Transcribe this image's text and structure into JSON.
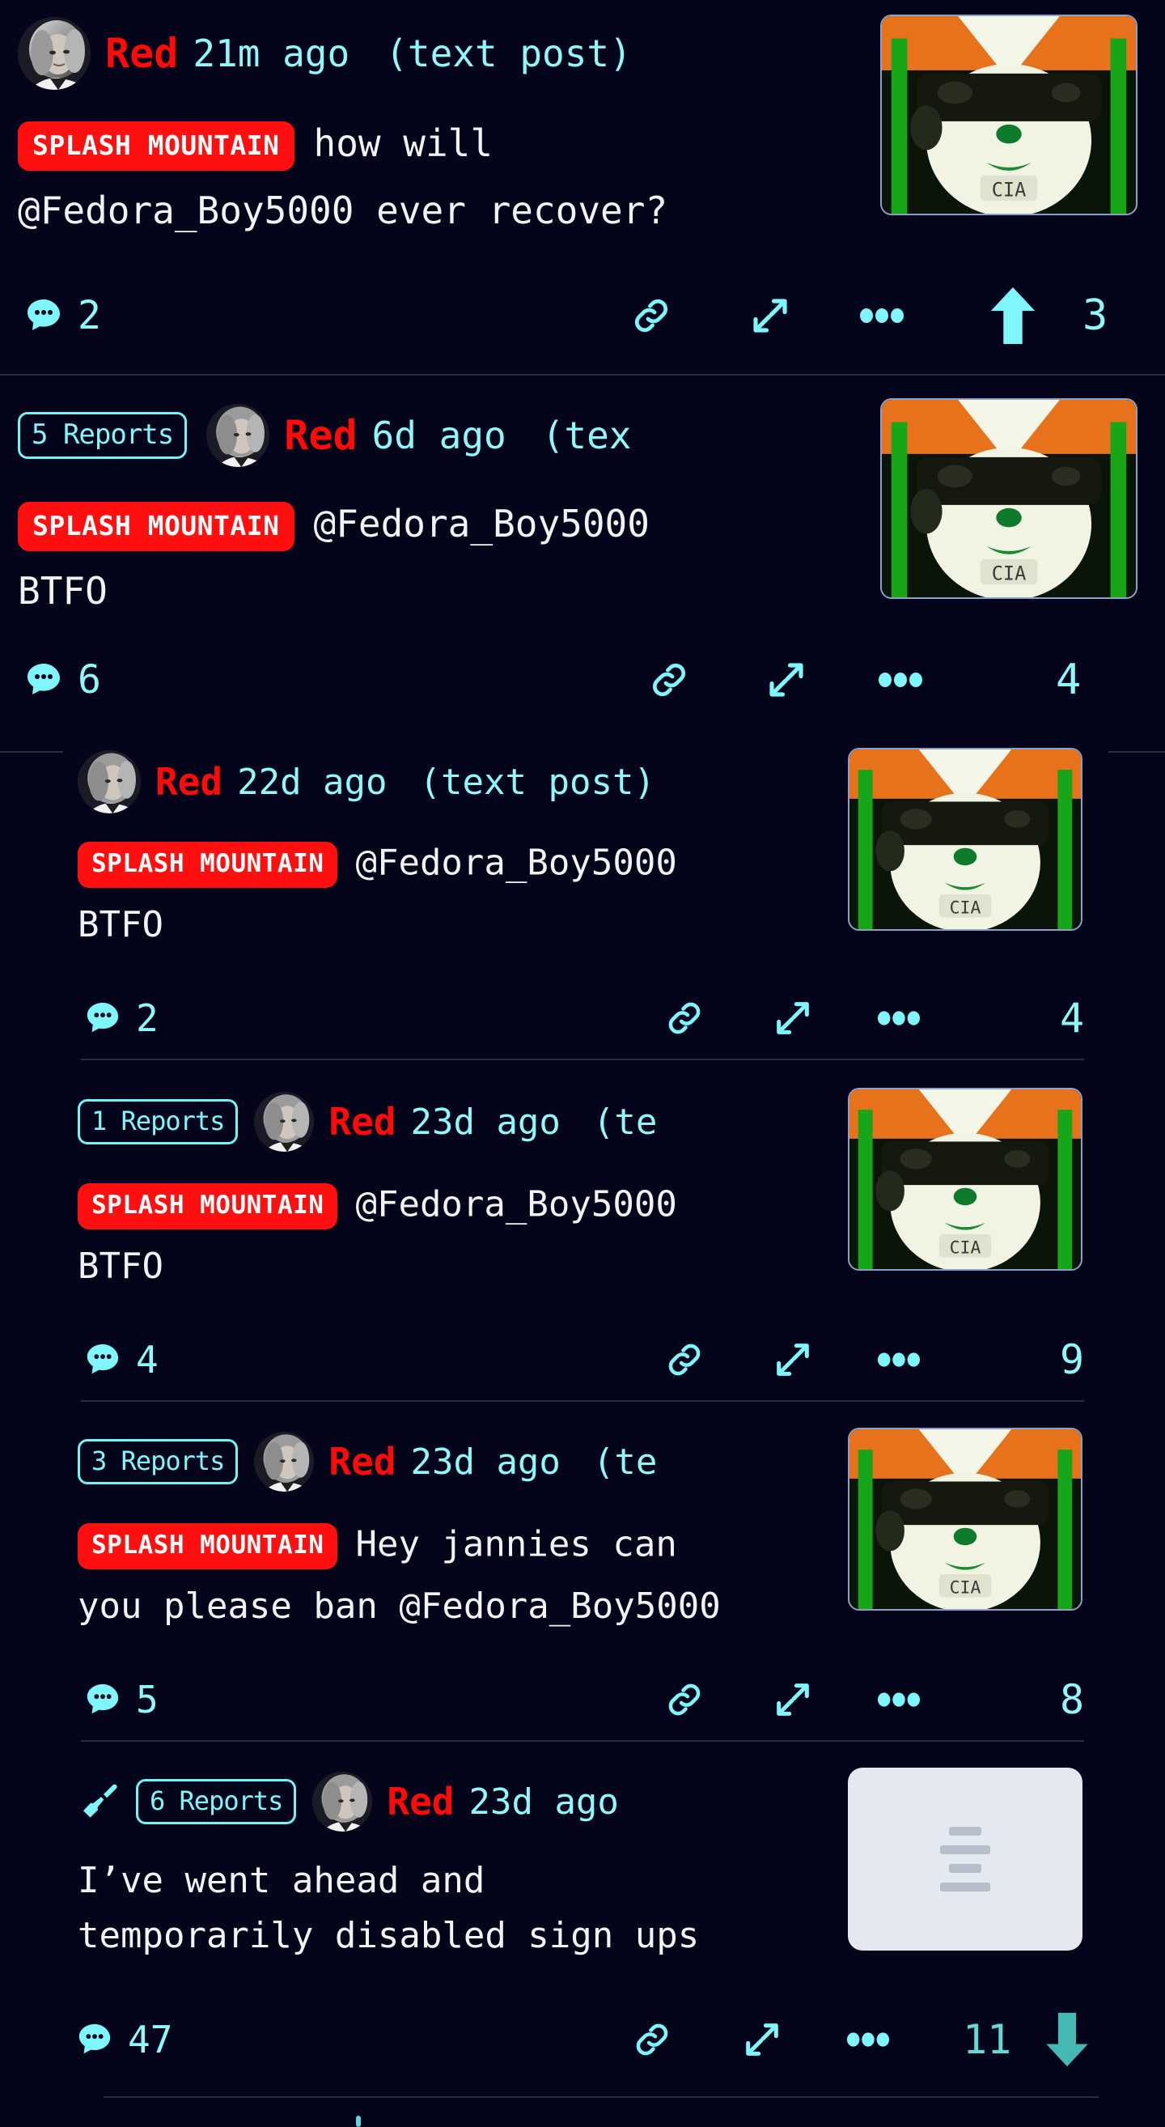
{
  "theme": {
    "background": "#04041a",
    "accent_cyan": "#7ef6fb",
    "username_red": "#ff0a0a",
    "flair_red": "#ff0f0f",
    "body_text": "#f2f2f7",
    "divider": "#2a2a46"
  },
  "posts": [
    {
      "id": "post-1",
      "reports": null,
      "mod_icon": null,
      "username": "Red",
      "timestamp": "21m ago",
      "post_type": "(text post)",
      "flair": "SPLASH MOUNTAIN",
      "body_lines": [
        "how will",
        "@Fedora_Boy5000 ever recover?"
      ],
      "comments": "2",
      "score": "3",
      "vote": "up",
      "thumbnail": "cia-dog-meme",
      "actions": [
        "comments",
        "link",
        "expand",
        "more",
        "upvote",
        "score"
      ]
    },
    {
      "id": "post-2",
      "reports": "5 Reports",
      "mod_icon": null,
      "username": "Red",
      "timestamp": "6d ago",
      "post_type": "(tex",
      "flair": "SPLASH MOUNTAIN",
      "body_lines": [
        "@Fedora_Boy5000",
        "BTFO"
      ],
      "comments": "6",
      "score": "4",
      "vote": null,
      "thumbnail": "cia-dog-meme",
      "actions": [
        "comments",
        "link",
        "expand",
        "more",
        "score"
      ]
    },
    {
      "id": "post-3",
      "reports": null,
      "mod_icon": null,
      "username": "Red",
      "timestamp": "22d ago",
      "post_type": "(text post)",
      "flair": "SPLASH MOUNTAIN",
      "body_lines": [
        "@Fedora_Boy5000",
        "BTFO"
      ],
      "comments": "2",
      "score": "4",
      "vote": null,
      "thumbnail": "cia-dog-meme",
      "actions": [
        "comments",
        "link",
        "expand",
        "more",
        "score"
      ]
    },
    {
      "id": "post-4",
      "reports": "1 Reports",
      "mod_icon": null,
      "username": "Red",
      "timestamp": "23d ago",
      "post_type": "(te",
      "flair": "SPLASH MOUNTAIN",
      "body_lines": [
        "@Fedora_Boy5000",
        "BTFO"
      ],
      "comments": "4",
      "score": "9",
      "vote": null,
      "thumbnail": "cia-dog-meme",
      "actions": [
        "comments",
        "link",
        "expand",
        "more",
        "score"
      ]
    },
    {
      "id": "post-5",
      "reports": "3 Reports",
      "mod_icon": null,
      "username": "Red",
      "timestamp": "23d ago",
      "post_type": "(te",
      "flair": "SPLASH MOUNTAIN",
      "body_lines": [
        "Hey jannies can",
        "you please ban @Fedora_Boy5000"
      ],
      "comments": "5",
      "score": "8",
      "vote": null,
      "thumbnail": "cia-dog-meme",
      "actions": [
        "comments",
        "link",
        "expand",
        "more",
        "score"
      ]
    },
    {
      "id": "post-6",
      "reports": "6 Reports",
      "mod_icon": "broom-icon",
      "username": "Red",
      "timestamp": "23d ago",
      "post_type": null,
      "flair": null,
      "body_lines": [
        "I’ve went ahead and",
        "temporarily disabled sign ups"
      ],
      "comments": "47",
      "score": "11",
      "vote": "down",
      "thumbnail": "text-document-placeholder",
      "actions": [
        "comments",
        "link",
        "expand",
        "more",
        "score",
        "downvote"
      ]
    }
  ],
  "icons": {
    "comments": "speech-bubble-icon",
    "link": "link-chain-icon",
    "expand": "expand-arrows-icon",
    "more": "ellipsis-icon",
    "upvote": "arrow-up-icon",
    "downvote": "arrow-down-icon",
    "broom": "broom-icon",
    "avatar": "user-avatar"
  }
}
